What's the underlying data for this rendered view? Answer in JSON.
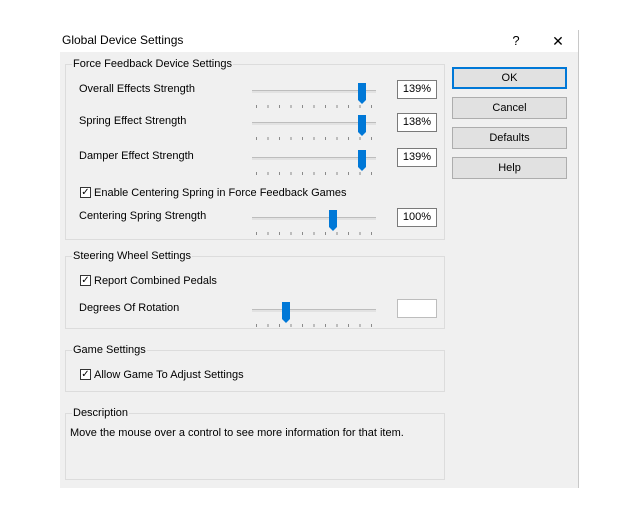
{
  "window": {
    "title": "Global Device Settings",
    "help_glyph": "?",
    "close_glyph": "✕"
  },
  "ffb": {
    "group_label": "Force Feedback Device Settings",
    "overall": {
      "label": "Overall Effects Strength",
      "value": "139%",
      "level": 0.9
    },
    "spring": {
      "label": "Spring Effect Strength",
      "value": "138%",
      "level": 0.9
    },
    "damper": {
      "label": "Damper Effect Strength",
      "value": "139%",
      "level": 0.9
    },
    "centering_checkbox": {
      "label": "Enable Centering Spring in Force Feedback Games",
      "checked": true
    },
    "centering": {
      "label": "Centering Spring Strength",
      "value": "100%",
      "level": 0.65
    }
  },
  "steering": {
    "group_label": "Steering Wheel Settings",
    "combined_pedals": {
      "label": "Report Combined Pedals",
      "checked": true
    },
    "rotation": {
      "label": "Degrees Of Rotation",
      "value": "",
      "level": 0.27
    }
  },
  "game": {
    "group_label": "Game Settings",
    "allow_adjust": {
      "label": "Allow Game To Adjust Settings",
      "checked": true
    }
  },
  "description": {
    "group_label": "Description",
    "text": "Move the mouse over a control to see more information for that item."
  },
  "buttons": {
    "ok": "OK",
    "cancel": "Cancel",
    "defaults": "Defaults",
    "help": "Help"
  },
  "colors": {
    "accent": "#0078d7",
    "dialog_bg": "#f0f0f0"
  },
  "check_glyph": "✓"
}
